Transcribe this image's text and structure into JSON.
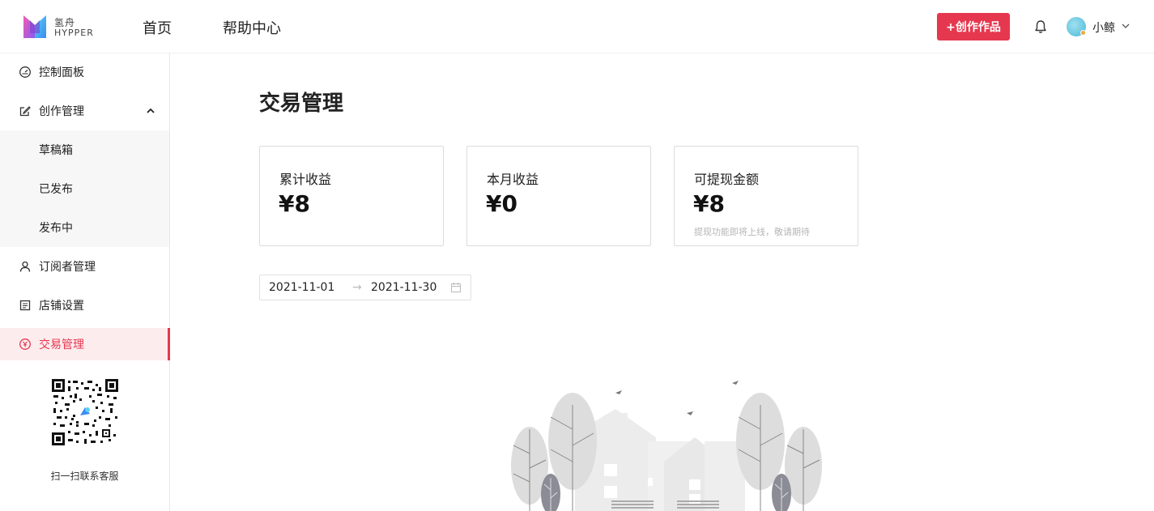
{
  "header": {
    "logo_cn": "氢舟",
    "logo_en": "HYPPER",
    "nav": [
      {
        "label": "首页"
      },
      {
        "label": "帮助中心"
      }
    ],
    "create_label": "+创作作品",
    "username": "小鲸",
    "accent": "#e5384f"
  },
  "sidebar": {
    "items": [
      {
        "label": "控制面板",
        "icon": "dashboard-icon"
      },
      {
        "label": "创作管理",
        "icon": "edit-icon",
        "expanded": true
      },
      {
        "label": "草稿箱"
      },
      {
        "label": "已发布"
      },
      {
        "label": "发布中"
      },
      {
        "label": "订阅者管理",
        "icon": "user-icon"
      },
      {
        "label": "店铺设置",
        "icon": "store-icon"
      },
      {
        "label": "交易管理",
        "icon": "yen-icon",
        "active": true
      }
    ],
    "qr_caption": "扫一扫联系客服"
  },
  "main": {
    "title": "交易管理",
    "cards": [
      {
        "label": "累计收益",
        "value": "¥8"
      },
      {
        "label": "本月收益",
        "value": "¥0"
      },
      {
        "label": "可提现金额",
        "value": "¥8",
        "note": "提现功能即将上线，敬请期待"
      }
    ],
    "date_range": {
      "start": "2021-11-01",
      "separator": "→",
      "end": "2021-11-30"
    }
  }
}
